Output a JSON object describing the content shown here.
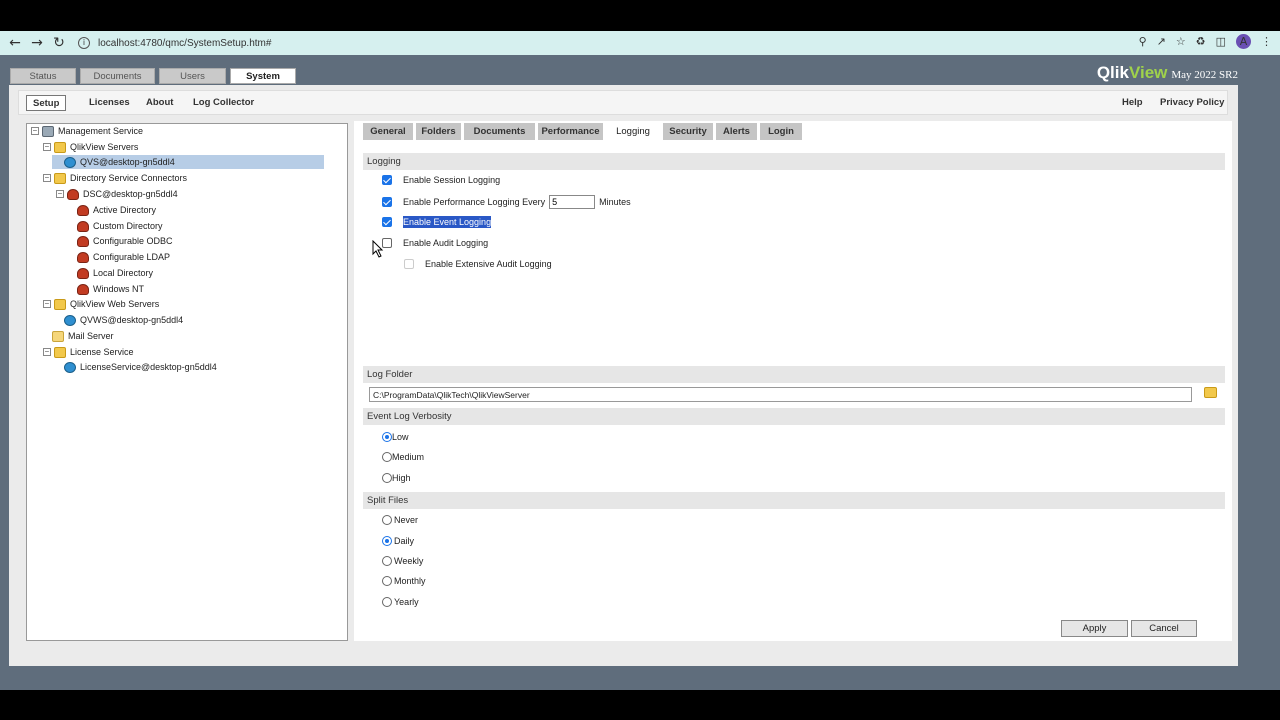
{
  "browser": {
    "url": "localhost:4780/qmc/SystemSetup.htm#",
    "avatar_letter": "A"
  },
  "brand": {
    "qlik": "Qlik",
    "view": "View",
    "version": "May 2022 SR2",
    "accent": "#9fd24b"
  },
  "main_tabs": [
    "Status",
    "Documents",
    "Users",
    "System"
  ],
  "sub_tabs": {
    "setup": "Setup",
    "licenses": "Licenses",
    "about": "About",
    "log_collector": "Log Collector",
    "help": "Help",
    "privacy": "Privacy Policy"
  },
  "tree": {
    "management_service": "Management Service",
    "qlikview_servers": "QlikView Servers",
    "qvs": "QVS@desktop-gn5ddl4",
    "directory_service_connectors": "Directory Service Connectors",
    "dsc": "DSC@desktop-gn5ddl4",
    "active_directory": "Active Directory",
    "custom_directory": "Custom Directory",
    "configurable_odbc": "Configurable ODBC",
    "configurable_ldap": "Configurable LDAP",
    "local_directory": "Local Directory",
    "windows_nt": "Windows NT",
    "qlikview_web_servers": "QlikView Web Servers",
    "qvws": "QVWS@desktop-gn5ddl4",
    "mail_server": "Mail Server",
    "license_service": "License Service",
    "license_service_item": "LicenseService@desktop-gn5ddl4"
  },
  "content_tabs": [
    "General",
    "Folders",
    "Documents",
    "Performance",
    "Logging",
    "Security",
    "Alerts",
    "Login"
  ],
  "logging": {
    "header": "Logging",
    "session": "Enable Session Logging",
    "performance_prefix": "Enable Performance Logging Every",
    "performance_value": "5",
    "performance_suffix": "Minutes",
    "event": "Enable Event Logging",
    "audit": "Enable Audit Logging",
    "extensive_audit": "Enable Extensive Audit Logging"
  },
  "log_folder": {
    "header": "Log Folder",
    "path": "C:\\ProgramData\\QlikTech\\QlikViewServer"
  },
  "verbosity": {
    "header": "Event Log Verbosity",
    "options": [
      "Low",
      "Medium",
      "High"
    ],
    "selected": "Low"
  },
  "split_files": {
    "header": "Split Files",
    "options": [
      "Never",
      "Daily",
      "Weekly",
      "Monthly",
      "Yearly"
    ],
    "selected": "Daily"
  },
  "buttons": {
    "apply": "Apply",
    "cancel": "Cancel"
  }
}
